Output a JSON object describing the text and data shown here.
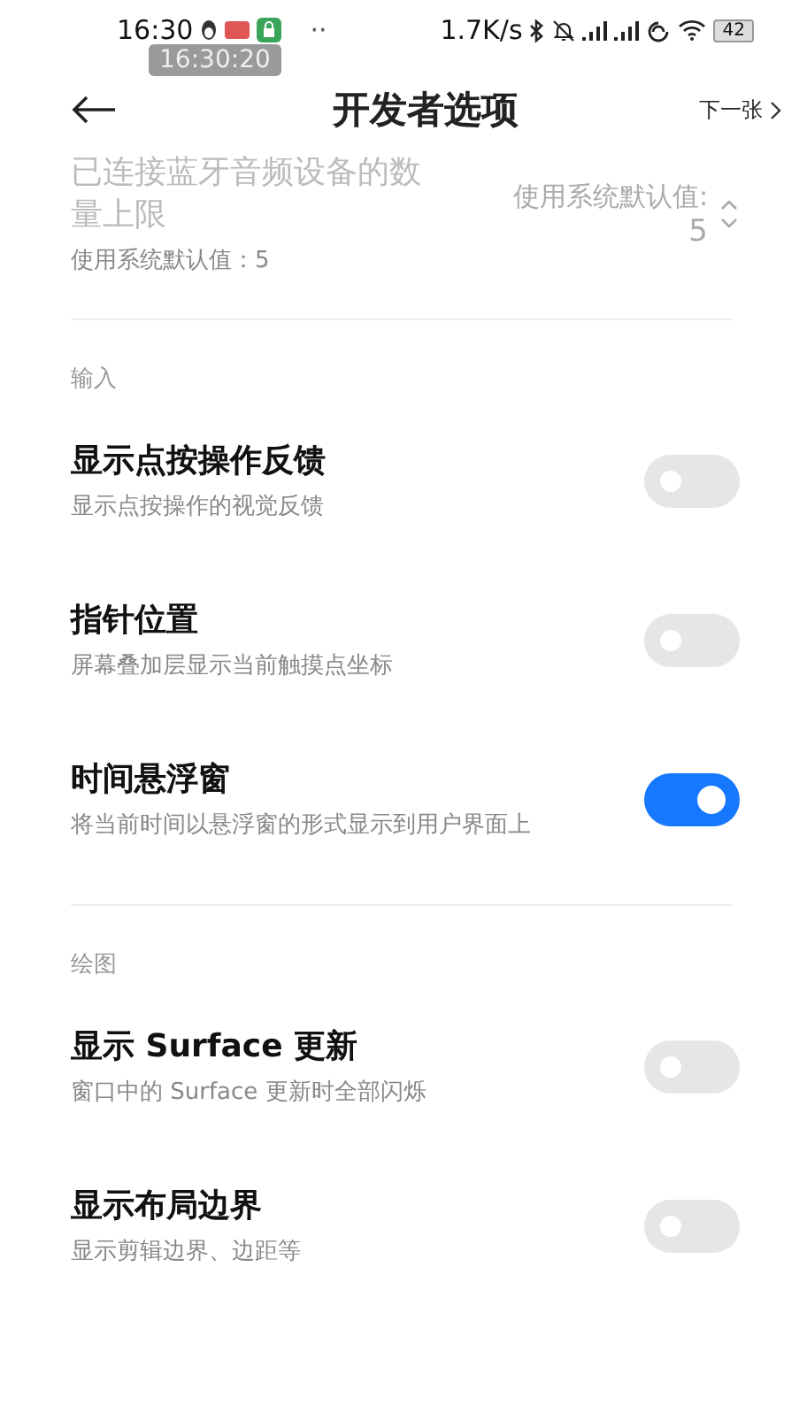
{
  "status_bar": {
    "time": "16:30",
    "dots": "··",
    "speed": "1.7K/s",
    "battery": "42",
    "overlay_time": "16:30:20"
  },
  "header": {
    "title": "开发者选项",
    "next": "下一张"
  },
  "sections": [
    {
      "items": [
        {
          "kind": "spinner",
          "title": "已连接蓝牙音频设备的数量上限",
          "subtitle": "使用系统默认值：5",
          "value_label": "使用系统默认值:",
          "value": "5"
        }
      ]
    },
    {
      "title": "输入",
      "items": [
        {
          "kind": "toggle",
          "title": "显示点按操作反馈",
          "subtitle": "显示点按操作的视觉反馈",
          "on": false
        },
        {
          "kind": "toggle",
          "title": "指针位置",
          "subtitle": "屏幕叠加层显示当前触摸点坐标",
          "on": false
        },
        {
          "kind": "toggle",
          "title": "时间悬浮窗",
          "subtitle": "将当前时间以悬浮窗的形式显示到用户界面上",
          "on": true
        }
      ]
    },
    {
      "title": "绘图",
      "items": [
        {
          "kind": "toggle",
          "title": "显示 Surface 更新",
          "subtitle": "窗口中的 Surface 更新时全部闪烁",
          "on": false
        },
        {
          "kind": "toggle",
          "title": "显示布局边界",
          "subtitle": "显示剪辑边界、边距等",
          "on": false
        }
      ]
    }
  ]
}
